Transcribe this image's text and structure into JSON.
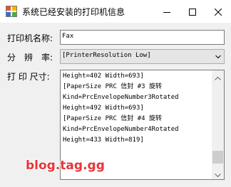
{
  "window": {
    "title": "系统已经安装的打印机信息",
    "icon": "printer-app-icon",
    "controls": [
      "minimize-icon",
      "maximize-icon",
      "close-icon"
    ]
  },
  "form": {
    "printer_name_label": "打印机名称:",
    "printer_name_value": "Fax",
    "resolution_label": "分　辨　率:",
    "resolution_selected": "[PrinterResolution Low]",
    "paper_size_label": "打 印 尺寸:",
    "paper_size_lines": [
      "Height=402 Width=693]",
      "[PaperSize PRC 信封 #3 旋转",
      "Kind=PrcEnvelopeNumber3Rotated",
      "Height=492 Width=693]",
      "[PaperSize PRC 信封 #4 旋转",
      "Kind=PrcEnvelopeNumber4Rotated",
      "Height=433 Width=819]",
      ""
    ]
  },
  "watermark": {
    "text": "blog.tag.gg"
  },
  "colors": {
    "window_background": "#f0f0f0",
    "titlebar_background": "#ffffff",
    "watermark": "#e8353a"
  }
}
